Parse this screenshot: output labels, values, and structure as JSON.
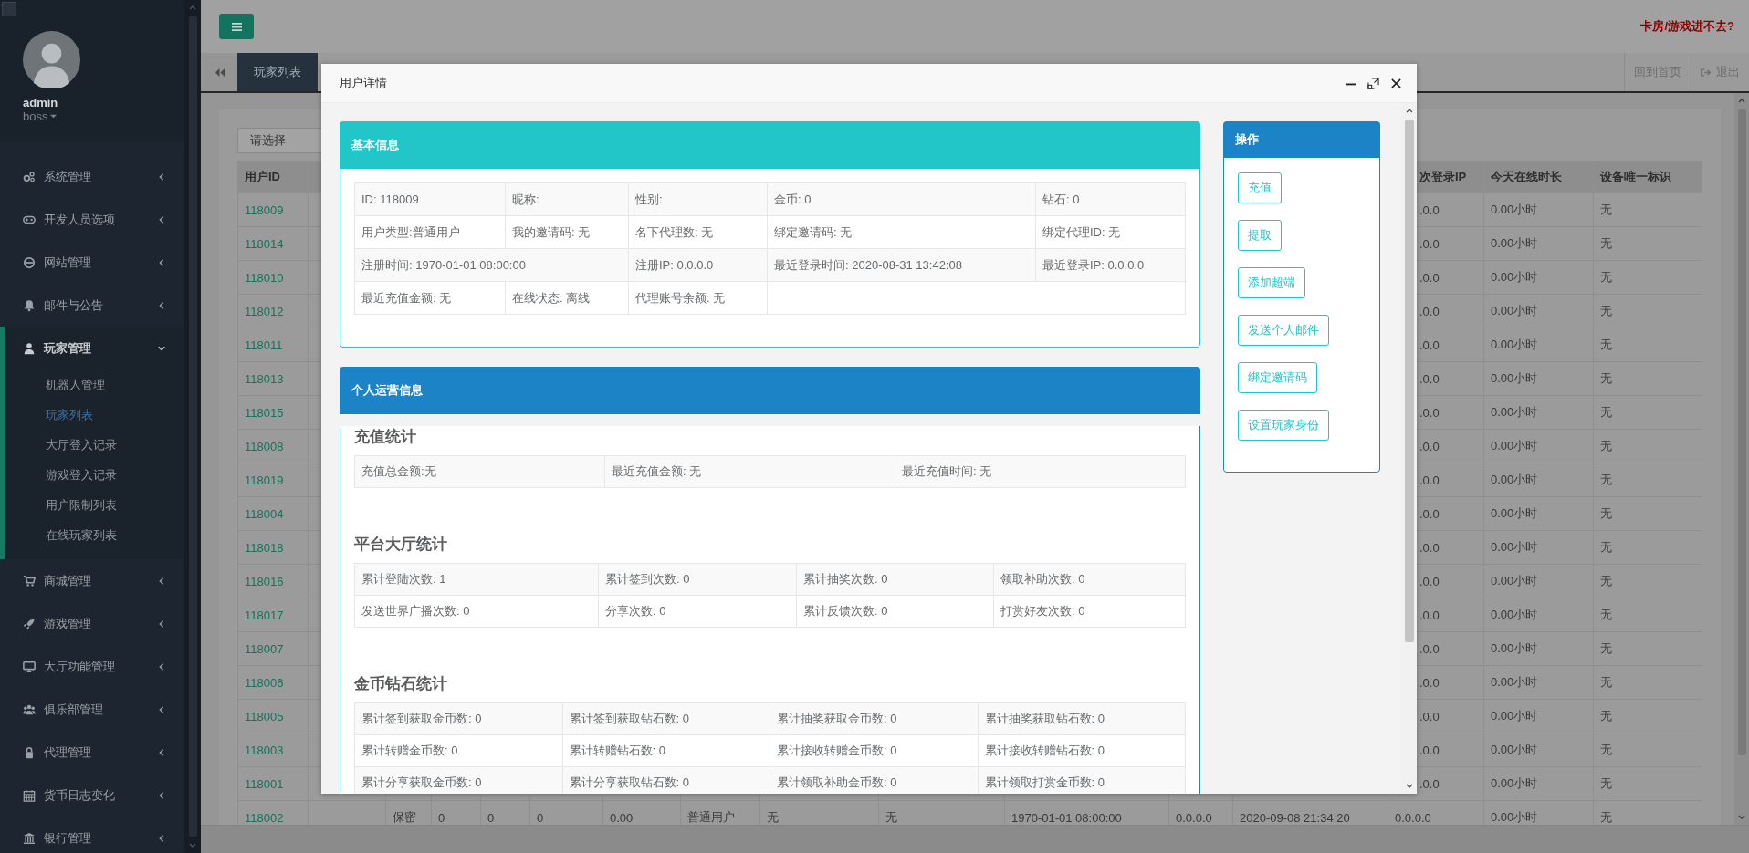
{
  "sidebar": {
    "user": {
      "name": "admin",
      "role": "boss"
    },
    "menu": [
      {
        "label": "系统管理",
        "expanded": false
      },
      {
        "label": "开发人员选项",
        "expanded": false
      },
      {
        "label": "网站管理",
        "expanded": false
      },
      {
        "label": "邮件与公告",
        "expanded": false
      },
      {
        "label": "玩家管理",
        "expanded": true,
        "children": [
          {
            "label": "机器人管理",
            "selected": false
          },
          {
            "label": "玩家列表",
            "selected": true
          },
          {
            "label": "大厅登入记录",
            "selected": false
          },
          {
            "label": "游戏登入记录",
            "selected": false
          },
          {
            "label": "用户限制列表",
            "selected": false
          },
          {
            "label": "在线玩家列表",
            "selected": false
          }
        ]
      },
      {
        "label": "商城管理",
        "expanded": false
      },
      {
        "label": "游戏管理",
        "expanded": false
      },
      {
        "label": "大厅功能管理",
        "expanded": false
      },
      {
        "label": "俱乐部管理",
        "expanded": false
      },
      {
        "label": "代理管理",
        "expanded": false
      },
      {
        "label": "货币日志变化",
        "expanded": false
      },
      {
        "label": "银行管理",
        "expanded": false
      }
    ]
  },
  "topbar": {
    "notice": "卡房/游戏进不去?"
  },
  "tabs": [
    {
      "label": "玩家列表",
      "selected": true
    }
  ],
  "header_links": [
    {
      "label": "回到首页"
    },
    {
      "label": "退出"
    }
  ],
  "filter": {
    "value": "请选择"
  },
  "table": {
    "columns": {
      "user_id": "用户ID",
      "last_login_ip": "次登录IP",
      "online_today": "今天在线时长",
      "device_id": "设备唯一标识"
    },
    "rows": [
      {
        "user_id": "118009",
        "last_login_ip": ".0.0",
        "online_today": "0.00小时",
        "device_id": "无"
      },
      {
        "user_id": "118014",
        "last_login_ip": ".0.0",
        "online_today": "0.00小时",
        "device_id": "无"
      },
      {
        "user_id": "118010",
        "last_login_ip": ".0.0",
        "online_today": "0.00小时",
        "device_id": "无"
      },
      {
        "user_id": "118012",
        "last_login_ip": ".0.0",
        "online_today": "0.00小时",
        "device_id": "无"
      },
      {
        "user_id": "118011",
        "last_login_ip": ".0.0",
        "online_today": "0.00小时",
        "device_id": "无"
      },
      {
        "user_id": "118013",
        "last_login_ip": ".0.0",
        "online_today": "0.00小时",
        "device_id": "无"
      },
      {
        "user_id": "118015",
        "last_login_ip": ".0.0",
        "online_today": "0.00小时",
        "device_id": "无"
      },
      {
        "user_id": "118008",
        "last_login_ip": ".0.0",
        "online_today": "0.00小时",
        "device_id": "无"
      },
      {
        "user_id": "118019",
        "last_login_ip": ".0.0",
        "online_today": "0.00小时",
        "device_id": "无"
      },
      {
        "user_id": "118004",
        "last_login_ip": ".0.0",
        "online_today": "0.00小时",
        "device_id": "无"
      },
      {
        "user_id": "118018",
        "last_login_ip": ".0.0",
        "online_today": "0.00小时",
        "device_id": "无"
      },
      {
        "user_id": "118016",
        "last_login_ip": ".0.0",
        "online_today": "0.00小时",
        "device_id": "无"
      },
      {
        "user_id": "118017",
        "last_login_ip": ".0.0",
        "online_today": "0.00小时",
        "device_id": "无"
      },
      {
        "user_id": "118007",
        "last_login_ip": ".0.0",
        "online_today": "0.00小时",
        "device_id": "无"
      },
      {
        "user_id": "118006",
        "last_login_ip": ".0.0",
        "online_today": "0.00小时",
        "device_id": "无"
      },
      {
        "user_id": "118005",
        "last_login_ip": ".0.0",
        "online_today": "0.00小时",
        "device_id": "无"
      },
      {
        "user_id": "118003",
        "last_login_ip": ".0.0",
        "online_today": "0.00小时",
        "device_id": "无"
      },
      {
        "user_id": "118001",
        "last_login_ip": ".0.0",
        "online_today": "0.00小时",
        "device_id": "无"
      }
    ],
    "full_rows": [
      {
        "cells": [
          "118002",
          "保密",
          "0",
          "0",
          "0",
          "0.00",
          "普通用户",
          "无",
          "无",
          "1970-01-01 08:00:00",
          "0.0.0.0",
          "2020-09-08 21:34:20",
          "0.0.0.0",
          "0.00小时",
          "无"
        ]
      }
    ]
  },
  "modal": {
    "title": "用户详情",
    "basic": {
      "title": "基本信息",
      "rows": [
        [
          "ID: 118009",
          "昵称:",
          "性别:",
          "金币: 0",
          "钻石: 0"
        ],
        [
          "用户类型:普通用户",
          "我的邀请码: 无",
          "名下代理数: 无",
          "绑定邀请码: 无",
          "绑定代理ID: 无"
        ],
        [
          {
            "text": "注册时间: 1970-01-01 08:00:00",
            "colspan": 2
          },
          "注册IP: 0.0.0.0",
          "最近登录时间: 2020-08-31 13:42:08",
          "最近登录IP: 0.0.0.0"
        ],
        [
          "最近充值金额: 无",
          "在线状态: 离线",
          "代理账号余额: 无",
          {
            "colspan": 2
          }
        ]
      ]
    },
    "operations": {
      "title": "个人运营信息",
      "sections": [
        {
          "title": "充值统计",
          "rows": [
            [
              "充值总金额:无",
              "最近充值金额: 无",
              "最近充值时间: 无"
            ]
          ]
        },
        {
          "title": "平台大厅统计",
          "rows": [
            [
              "累计登陆次数: 1",
              "累计签到次数: 0",
              "累计抽奖次数: 0",
              "领取补助次数: 0"
            ],
            [
              "发送世界广播次数: 0",
              "分享次数: 0",
              "累计反馈次数: 0",
              "打赏好友次数: 0"
            ]
          ]
        },
        {
          "title": "金币钻石统计",
          "rows": [
            [
              "累计签到获取金币数: 0",
              "累计签到获取钻石数: 0",
              "累计抽奖获取金币数: 0",
              "累计抽奖获取钻石数: 0"
            ],
            [
              "累计转赠金币数: 0",
              "累计转赠钻石数: 0",
              "累计接收转赠金币数: 0",
              "累计接收转赠钻石数: 0"
            ],
            [
              "累计分享获取金币数: 0",
              "累计分享获取钻石数: 0",
              "累计领取补助金币数: 0",
              "累计领取打赏金币数: 0"
            ]
          ]
        }
      ]
    },
    "actions": {
      "title": "操作",
      "buttons": [
        "充值",
        "提取",
        "添加超端",
        "发送个人邮件",
        "绑定邀请码",
        "设置玩家身份"
      ]
    }
  }
}
